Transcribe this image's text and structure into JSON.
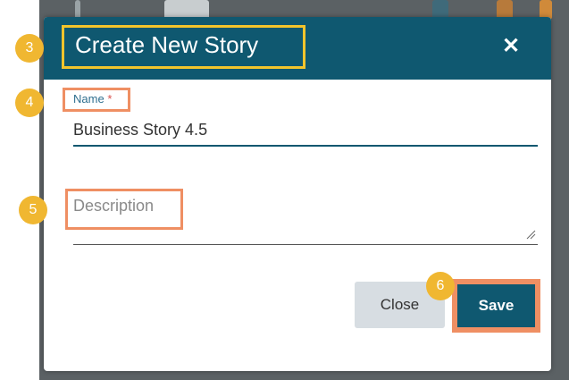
{
  "dialog": {
    "title": "Create New Story",
    "close_icon": "close-icon",
    "name_label": "Name",
    "required_marker": "*",
    "name_value": "Business Story 4.5",
    "description_placeholder": "Description",
    "close_button": "Close",
    "save_button": "Save"
  },
  "callouts": {
    "step_title": "3",
    "step_name": "4",
    "step_description": "5",
    "step_save": "6"
  },
  "colors": {
    "header": "#0f5870",
    "highlight_yellow": "#f2c42c",
    "highlight_orange": "#ef8f63",
    "badge": "#f0b731",
    "close_button_bg": "#d7dde2"
  }
}
